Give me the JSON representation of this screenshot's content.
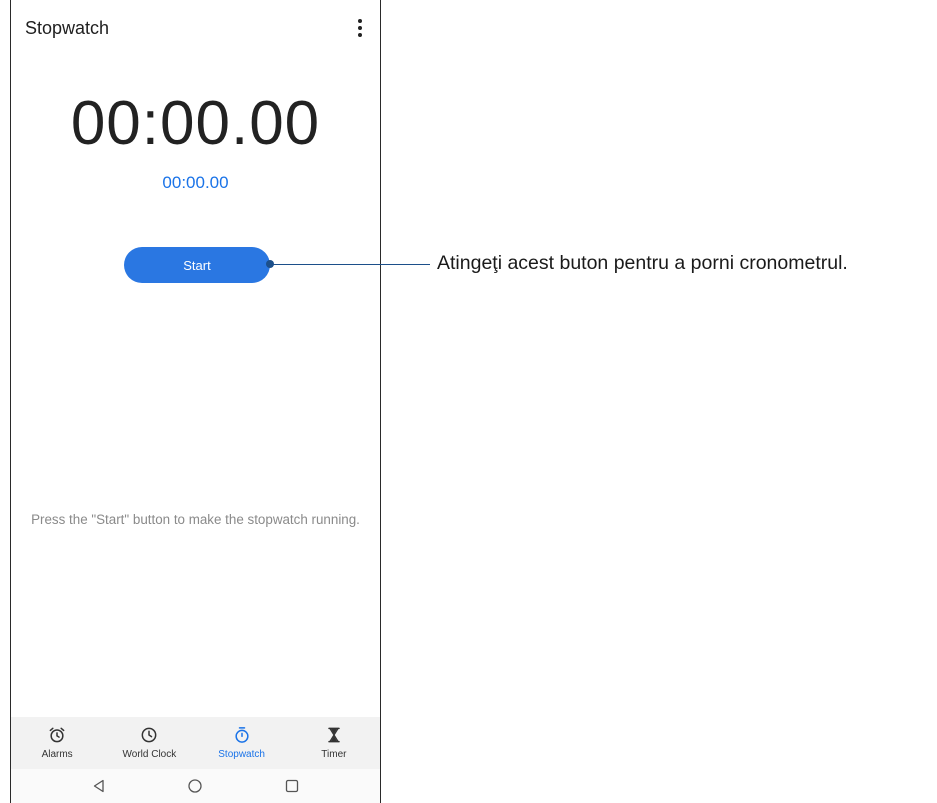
{
  "appbar": {
    "title": "Stopwatch",
    "menu_icon": "more-vert-icon"
  },
  "stopwatch": {
    "main_time": "00:00.00",
    "lap_time": "00:00.00",
    "start_label": "Start",
    "hint": "Press the \"Start\" button to make the stopwatch running."
  },
  "bottom_nav": {
    "items": [
      {
        "label": "Alarms",
        "icon": "alarm-icon",
        "active": false
      },
      {
        "label": "World Clock",
        "icon": "clock-icon",
        "active": false
      },
      {
        "label": "Stopwatch",
        "icon": "stopwatch-icon",
        "active": true
      },
      {
        "label": "Timer",
        "icon": "hourglass-icon",
        "active": false
      }
    ]
  },
  "system_nav": {
    "back_icon": "back-triangle-icon",
    "home_icon": "home-circle-icon",
    "recents_icon": "recents-square-icon"
  },
  "callout": {
    "text": "Atingeţi acest buton pentru a porni cronometrul."
  },
  "colors": {
    "accent": "#1a73e8",
    "button": "#2a77e2",
    "callout_line": "#1c4f8a"
  }
}
